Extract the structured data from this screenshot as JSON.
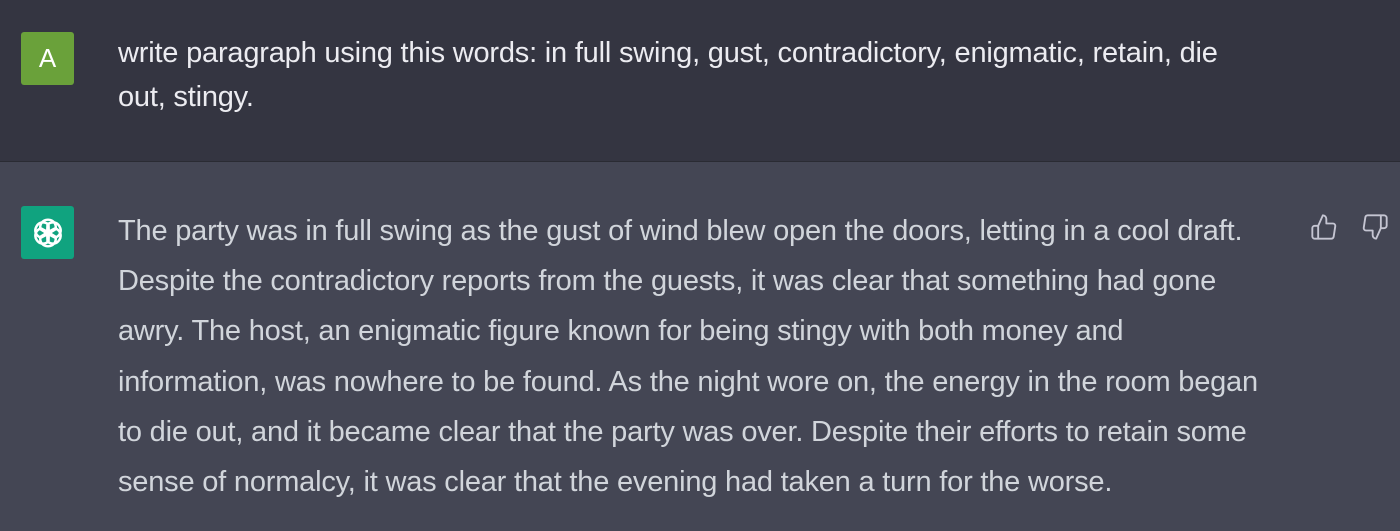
{
  "user": {
    "avatar_letter": "A",
    "message": "write paragraph using this words: in full swing, gust, contradictory, enigmatic, retain, die\nout, stingy."
  },
  "assistant": {
    "avatar_icon": "openai-logo-icon",
    "message": "The party was in full swing as the gust of wind blew open the doors, letting in a cool draft.\nDespite the contradictory reports from the guests, it was clear that something had gone\nawry. The host, an enigmatic figure known for being stingy with both money and\ninformation, was nowhere to be found. As the night wore on, the energy in the room began\nto die out, and it became clear that the party was over. Despite their efforts to retain some\nsense of normalcy, it was clear that the evening had taken a turn for the worse.",
    "feedback": {
      "up_icon": "thumbs-up-icon",
      "down_icon": "thumbs-down-icon"
    }
  },
  "colors": {
    "user_bg": "#343541",
    "assistant_bg": "#444654",
    "user_avatar": "#6aa13a",
    "assistant_avatar": "#10a37f",
    "text": "#ececf1"
  }
}
